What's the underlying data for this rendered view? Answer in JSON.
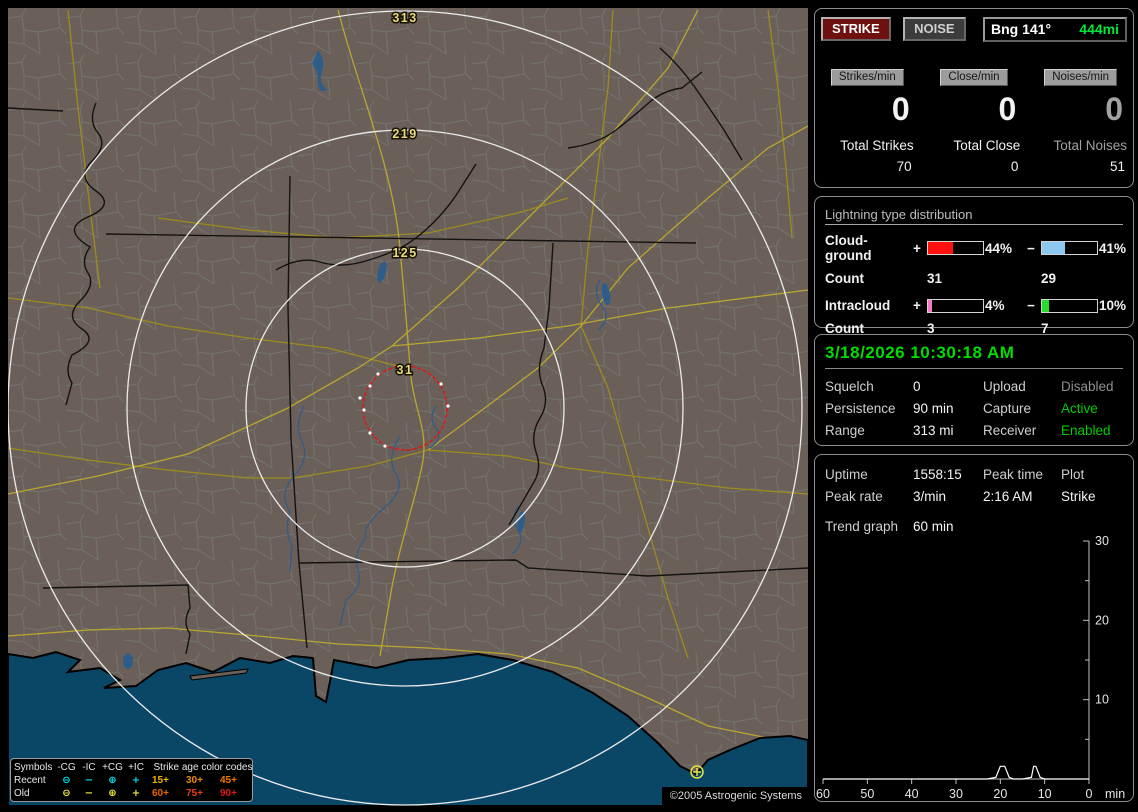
{
  "map": {
    "ring_labels": {
      "outer": "313",
      "mid": "219",
      "inner": "125",
      "close": "31"
    },
    "copyright": "©2005 Astrogenic Systems",
    "legend": {
      "symbols_header": "Symbols",
      "columns": [
        "-CG",
        "-IC",
        "+CG",
        "+IC"
      ],
      "age_header": "Strike age color codes",
      "recent_label": "Recent",
      "old_label": "Old",
      "recent_color": "#00dce8",
      "old_color": "#e8e83c",
      "recent_ages": [
        {
          "text": "15+",
          "color": "#f0b000"
        },
        {
          "text": "30+",
          "color": "#f08c00"
        },
        {
          "text": "45+",
          "color": "#f07800"
        }
      ],
      "old_ages": [
        {
          "text": "60+",
          "color": "#f06400"
        },
        {
          "text": "75+",
          "color": "#e84010"
        },
        {
          "text": "90+",
          "color": "#e01818"
        }
      ]
    }
  },
  "panel": {
    "mode_buttons": {
      "strike": "STRIKE",
      "noise": "NOISE"
    },
    "bearing": {
      "label": "Bng 141°",
      "distance": "444mi",
      "distance_color": "#00e83c"
    },
    "counters": {
      "strikes": {
        "header": "Strikes/min",
        "rate": "0",
        "total_label": "Total Strikes",
        "total": "70"
      },
      "close": {
        "header": "Close/min",
        "rate": "0",
        "total_label": "Total Close",
        "total": "0"
      },
      "noises": {
        "header": "Noises/min",
        "rate": "0",
        "total_label": "Total Noises",
        "total": "51"
      }
    },
    "distribution": {
      "title": "Lightning type distribution",
      "cloud_ground": {
        "label": "Cloud-ground",
        "plus_sign": "+",
        "minus_sign": "−",
        "pos_pct": "44%",
        "pos_fill": 45,
        "pos_color": "#ff1010",
        "neg_pct": "41%",
        "neg_fill": 42,
        "neg_color": "#8cc8f0",
        "count_label": "Count",
        "pos_count": "31",
        "neg_count": "29"
      },
      "intracloud": {
        "label": "Intracloud",
        "plus_sign": "+",
        "minus_sign": "−",
        "pos_pct": "4%",
        "pos_fill": 7,
        "pos_color": "#f878c8",
        "neg_pct": "10%",
        "neg_fill": 13,
        "neg_color": "#28dc28",
        "count_label": "Count",
        "pos_count": "3",
        "neg_count": "7"
      }
    },
    "clock": {
      "datetime": "3/18/2026 10:30:18 AM",
      "color": "#00dc00"
    },
    "status": {
      "squelch_label": "Squelch",
      "squelch": "0",
      "persistence_label": "Persistence",
      "persistence": "90 min",
      "range_label": "Range",
      "range": "313 mi",
      "upload_label": "Upload",
      "upload": "Disabled",
      "upload_color": "#909090",
      "capture_label": "Capture",
      "capture": "Active",
      "capture_color": "#00cc00",
      "receiver_label": "Receiver",
      "receiver": "Enabled",
      "receiver_color": "#00cc00"
    },
    "stats": {
      "uptime_label": "Uptime",
      "uptime": "1558:15",
      "peak_time_label": "Peak time",
      "plot_label": "Plot",
      "peak_rate_label": "Peak rate",
      "peak_rate": "3/min",
      "peak_time": "2:16 AM",
      "plot_value": "Strike",
      "trend_label": "Trend graph",
      "trend_window": "60 min"
    }
  },
  "chart_data": {
    "type": "line",
    "title": "Strike rate trend, last 60 minutes",
    "xlabel": "min",
    "x_ticks": [
      60,
      50,
      40,
      30,
      20,
      10,
      0
    ],
    "x_meaning": "minutes ago (right edge = now)",
    "ylim": [
      0,
      30
    ],
    "y_ticks": [
      10,
      20,
      30
    ],
    "y_minor_ticks": [
      5,
      15,
      25
    ],
    "y_axis_side": "right",
    "grid": false,
    "legend_position": "none",
    "series": [
      {
        "name": "Strike",
        "color": "#ffffff",
        "points": [
          [
            60,
            0
          ],
          [
            23,
            0
          ],
          [
            21,
            0.2
          ],
          [
            20,
            1.6
          ],
          [
            19,
            1.6
          ],
          [
            18,
            0.2
          ],
          [
            17,
            0
          ],
          [
            15,
            0
          ],
          [
            13,
            0.2
          ],
          [
            12.5,
            1.6
          ],
          [
            12,
            1.6
          ],
          [
            11,
            0.2
          ],
          [
            10,
            0
          ],
          [
            0,
            0
          ]
        ]
      }
    ]
  }
}
